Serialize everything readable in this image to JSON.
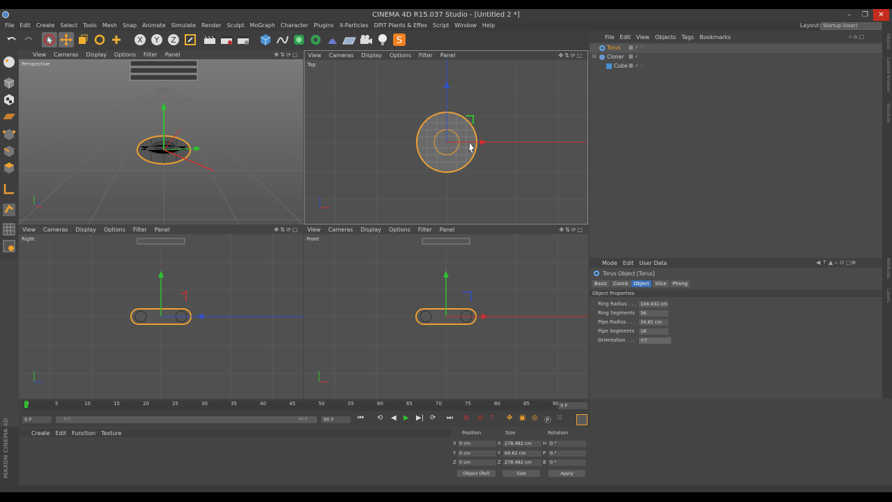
{
  "window": {
    "title": "CINEMA 4D R15.037 Studio - [Untitled 2 *]",
    "minimize": "–",
    "maximize": "❐",
    "close": "✕"
  },
  "menu": [
    "File",
    "Edit",
    "Create",
    "Select",
    "Tools",
    "Mesh",
    "Snap",
    "Animate",
    "Simulate",
    "Render",
    "Sculpt",
    "MoGraph",
    "Character",
    "Plugins",
    "X-Particles",
    "DPIT Plants & Effex",
    "Script",
    "Window",
    "Help"
  ],
  "layout": {
    "label": "Layout:",
    "value": "Startup (User)"
  },
  "viewport_menu": [
    "View",
    "Cameras",
    "Display",
    "Options",
    "Filter",
    "Panel"
  ],
  "viewports": {
    "tl": "Perspective",
    "tr": "Top",
    "bl": "Right",
    "br": "Front"
  },
  "object_manager": {
    "menu": [
      "File",
      "Edit",
      "View",
      "Objects",
      "Tags",
      "Bookmarks"
    ],
    "objects": [
      {
        "name": "Torus",
        "color": "#f0a030"
      },
      {
        "name": "Cloner",
        "color": "#d0d0d0"
      },
      {
        "name": "Cube",
        "color": "#d0d0d0"
      }
    ]
  },
  "attributes": {
    "menu": [
      "Mode",
      "Edit",
      "User Data"
    ],
    "object_title": "Torus Object [Torus]",
    "tabs": [
      "Basic",
      "Coord.",
      "Object",
      "Slice",
      "Phong"
    ],
    "active_tab": "Object",
    "section": "Object Properties",
    "props": [
      {
        "label": "Ring Radius . . .",
        "value": "104.431 cm"
      },
      {
        "label": "Ring Segments",
        "value": "36"
      },
      {
        "label": "Pipe Radius . . .",
        "value": "34.81 cm"
      },
      {
        "label": "Pipe Segments",
        "value": "18"
      },
      {
        "label": "Orientation . . .",
        "value": "+Y"
      }
    ]
  },
  "right_tabs": [
    "Objects",
    "Content Browser",
    "Structure",
    "Attributes",
    "Layers"
  ],
  "timeline": {
    "ticks": [
      "0",
      "5",
      "10",
      "15",
      "20",
      "25",
      "30",
      "35",
      "40",
      "45",
      "50",
      "55",
      "60",
      "65",
      "70",
      "75",
      "80",
      "85",
      "90"
    ],
    "current_frame": "0 F",
    "start_frame": "0 F",
    "end_frame": "90 F",
    "range_start": "0 F",
    "range_end": "90 F"
  },
  "material_menu": [
    "Create",
    "Edit",
    "Function",
    "Texture"
  ],
  "brand": "MAXON CINEMA 4D",
  "coords": {
    "headers": [
      "Position",
      "Size",
      "Rotation"
    ],
    "rows": [
      {
        "axis": "X",
        "pos": "0 cm",
        "saxis": "X",
        "size": "278.482 cm",
        "raxis": "H",
        "rot": "0 °"
      },
      {
        "axis": "Y",
        "pos": "0 cm",
        "saxis": "Y",
        "size": "69.62 cm",
        "raxis": "P",
        "rot": "0 °"
      },
      {
        "axis": "Z",
        "pos": "0 cm",
        "saxis": "Z",
        "size": "278.482 cm",
        "raxis": "B",
        "rot": "0 °"
      }
    ],
    "mode": "Object (Rel)",
    "size_mode": "Size",
    "apply": "Apply"
  },
  "colors": {
    "selection": "#f0a030",
    "x_axis": "#d03030",
    "y_axis": "#30c030",
    "z_axis": "#3050d0"
  }
}
